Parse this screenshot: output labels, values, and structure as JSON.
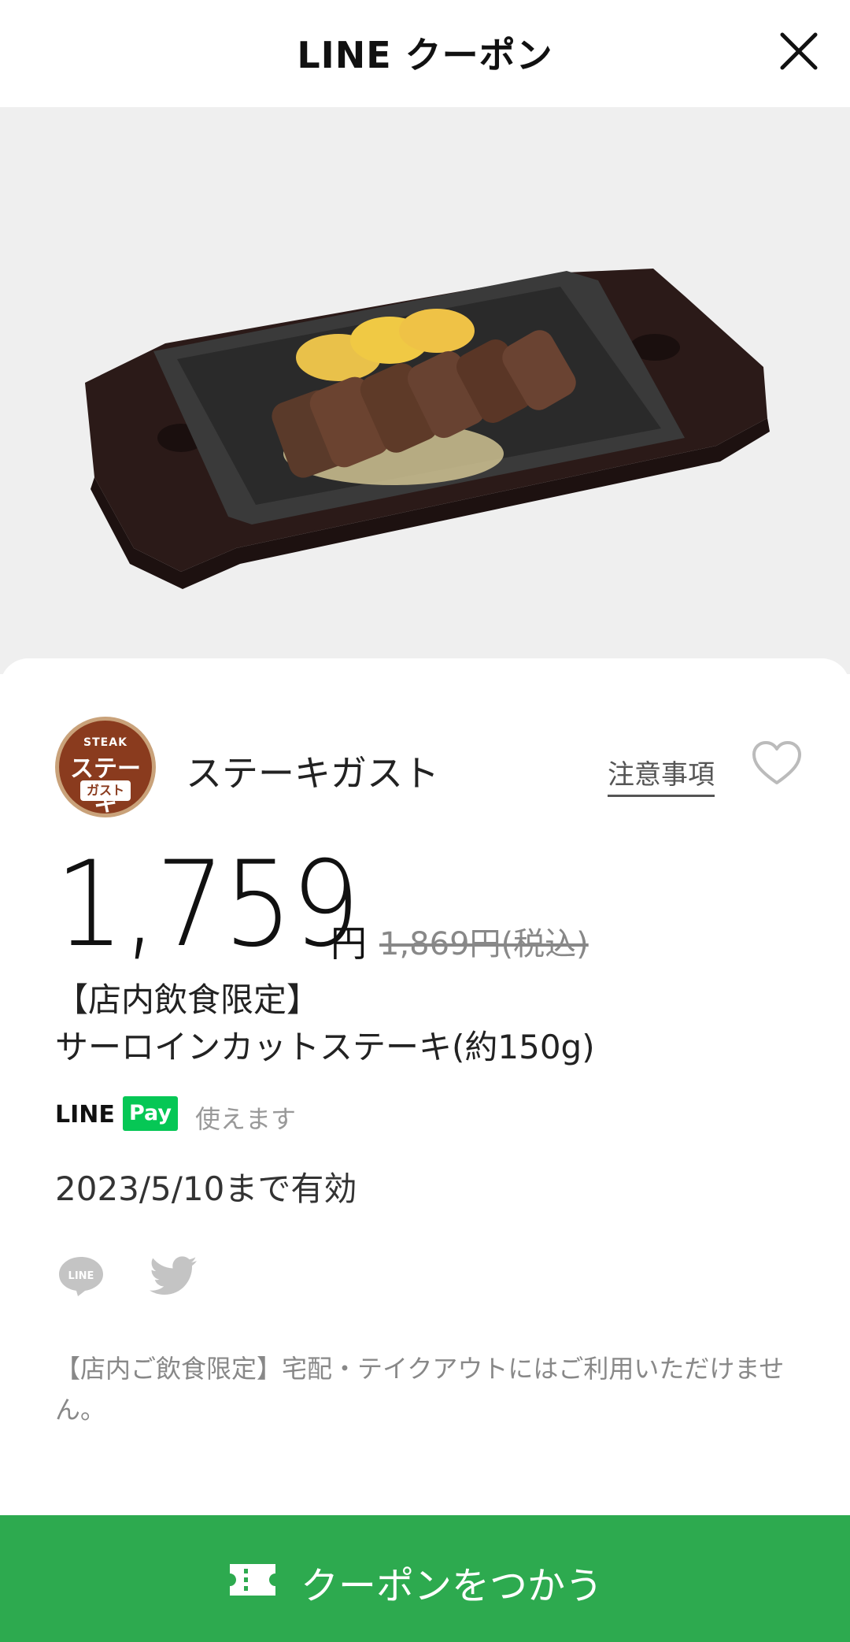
{
  "header": {
    "title": "LINE クーポン"
  },
  "hero": {
    "icon": "steak-plate-image"
  },
  "brand": {
    "logo_top": "STEAK",
    "logo_main": "ステーキ",
    "logo_sub": "ガスト",
    "name": "ステーキガスト",
    "notice_label": "注意事項"
  },
  "price": {
    "value": "1,759",
    "currency": "円",
    "original": "1,869円(税込)"
  },
  "coupon": {
    "title_line1": "【店内飲食限定】",
    "title_line2": "サーロインカットステーキ(約150g)"
  },
  "payment": {
    "line_text": "LINE",
    "badge_text": "Pay",
    "status": "使えます"
  },
  "validity": "2023/5/10まで有効",
  "share": {
    "line_label": "LINE"
  },
  "note": "【店内ご飲食限定】宅配・テイクアウトにはご利用いただけません。",
  "cta": {
    "label": "クーポンをつかう"
  },
  "colors": {
    "accent_green": "#2daa4f",
    "line_pay_green": "#06c755"
  }
}
